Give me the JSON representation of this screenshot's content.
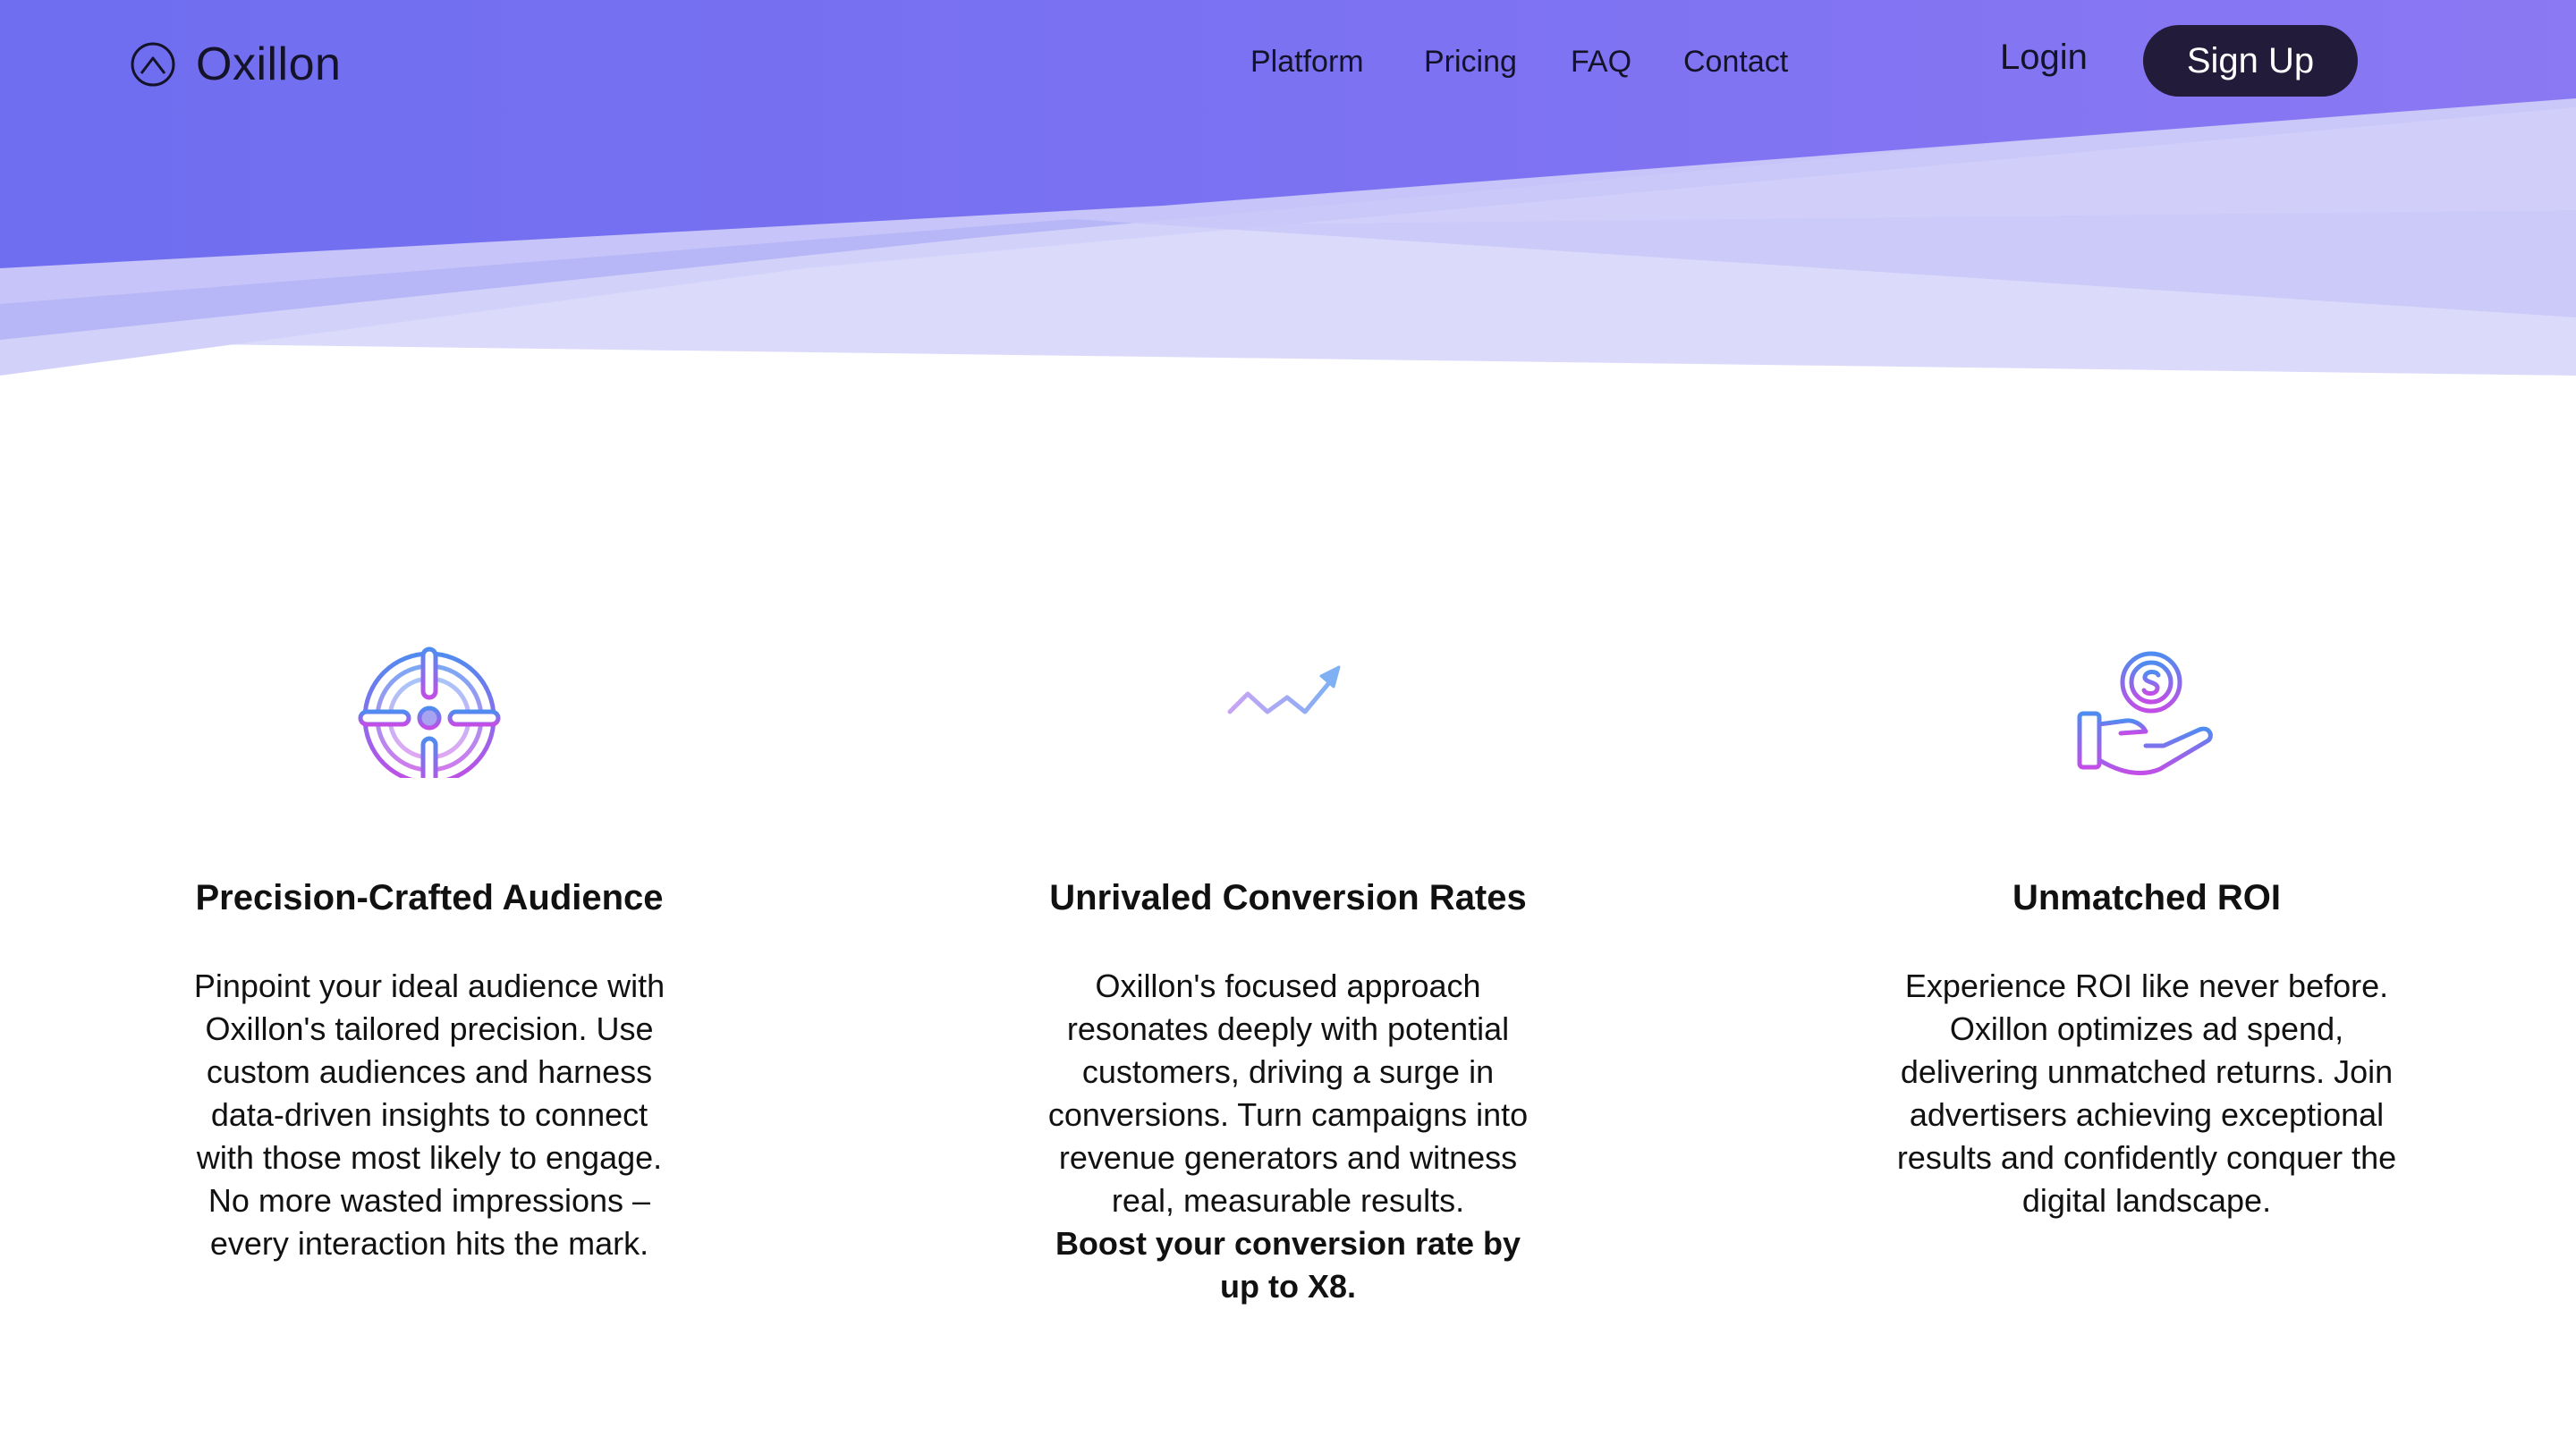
{
  "brand": {
    "name": "Oxillon",
    "logo_icon": "mountain-circle-icon"
  },
  "nav": {
    "links": [
      {
        "label": "Platform"
      },
      {
        "label": "Pricing"
      },
      {
        "label": "FAQ"
      },
      {
        "label": "Contact"
      }
    ],
    "login_label": "Login",
    "signup_label": "Sign Up"
  },
  "features": [
    {
      "icon": "target-icon",
      "title": "Precision-Crafted Audience",
      "body": "Pinpoint your ideal audience with Oxillon's tailored precision. Use custom audiences and harness data-driven insights to connect with those most likely to engage. No more wasted impressions – every interaction hits the mark.",
      "emphasis": ""
    },
    {
      "icon": "growth-chart-icon",
      "title": "Unrivaled Conversion Rates",
      "body": "Oxillon's focused approach resonates deeply with potential customers, driving a surge in conversions. Turn campaigns into revenue generators and witness real, measurable results.",
      "emphasis": "Boost your conversion rate by up to X8."
    },
    {
      "icon": "hand-coin-icon",
      "title": "Unmatched ROI",
      "body": "Experience ROI like never before. Oxillon optimizes ad spend, delivering unmatched returns. Join advertisers achieving exceptional results and confidently conquer the digital landscape.",
      "emphasis": ""
    }
  ],
  "colors": {
    "hero_primary": "#7b6ff2",
    "hero_light": "#d7d6fa",
    "button_dark": "#231b3a",
    "icon_gradient_start": "#4f8cf0",
    "icon_gradient_end": "#c24ee6"
  }
}
